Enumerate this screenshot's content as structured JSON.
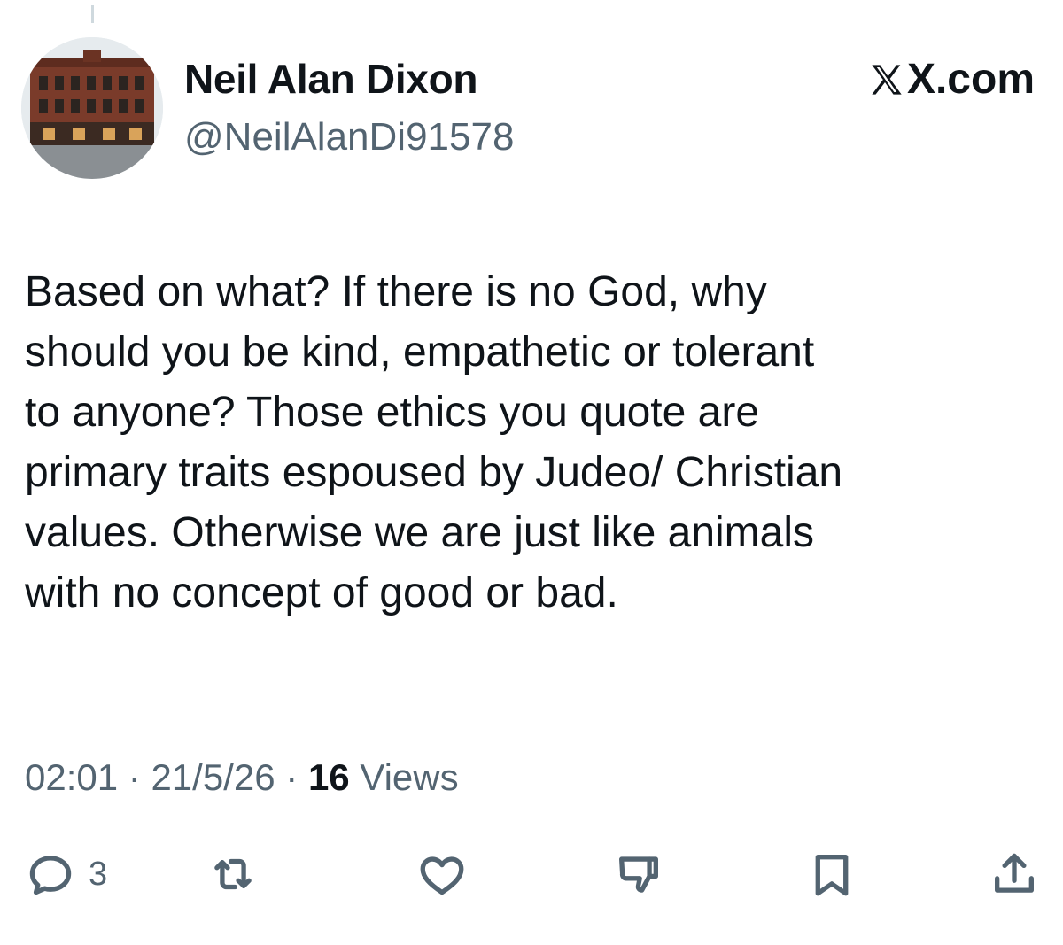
{
  "tweet": {
    "author": {
      "display_name": "Neil Alan Dixon",
      "handle": "@NeilAlanDi91578"
    },
    "brand": "X.com",
    "text": "Based on what? If there is no God, why\nshould you be kind, empathetic or tolerant\nto anyone? Those ethics you quote are\nprimary traits espoused by Judeo/ Christian\nvalues. Otherwise we are just like animals\nwith no concept of good or bad.",
    "time": "02:01",
    "date": "21/5/26",
    "separator": "·",
    "views_count": "16",
    "views_label": "Views",
    "reply_count": "3"
  },
  "icons": {
    "reply": "reply-icon",
    "retweet": "retweet-icon",
    "like": "heart-icon",
    "dislike": "thumbs-down-icon",
    "bookmark": "bookmark-icon",
    "share": "share-icon"
  },
  "colors": {
    "text": "#0f1419",
    "secondary": "#536471",
    "background": "#ffffff"
  }
}
